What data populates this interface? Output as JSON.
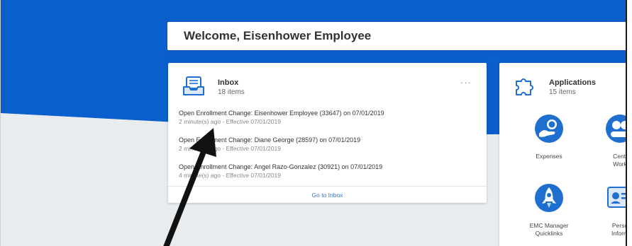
{
  "welcome": {
    "title": "Welcome, Eisenhower Employee"
  },
  "inbox": {
    "title": "Inbox",
    "count": "18 items",
    "more": "···",
    "items": [
      {
        "title": "Open Enrollment Change: Eisenhower Employee (33647) on 07/01/2019",
        "meta": "2 minute(s) ago - Effective 07/01/2019"
      },
      {
        "title": "Open Enrollment Change: Diane George (28597) on 07/01/2019",
        "meta": "2 minute(s) ago - Effective 07/01/2019"
      },
      {
        "title": "Open Enrollment Change: Angel Razo-Gonzalez (30921) on 07/01/2019",
        "meta": "4 minute(s) ago - Effective 07/01/2019"
      }
    ],
    "footer_link": "Go to Inbox"
  },
  "applications": {
    "title": "Applications",
    "count": "15 items",
    "tiles": [
      {
        "label": "Expenses",
        "icon": "expenses-icon"
      },
      {
        "label": "Centi\nWork",
        "icon": "center-work-icon"
      },
      {
        "label": "EMC Manager\nQuicklinks",
        "icon": "rocket-icon"
      },
      {
        "label": "Perso\nInform",
        "icon": "personal-info-icon"
      }
    ]
  },
  "colors": {
    "brand_blue": "#0a5fcc",
    "icon_blue": "#1f6fd1",
    "link_blue": "#3a73c4",
    "arrow": "#111111"
  }
}
